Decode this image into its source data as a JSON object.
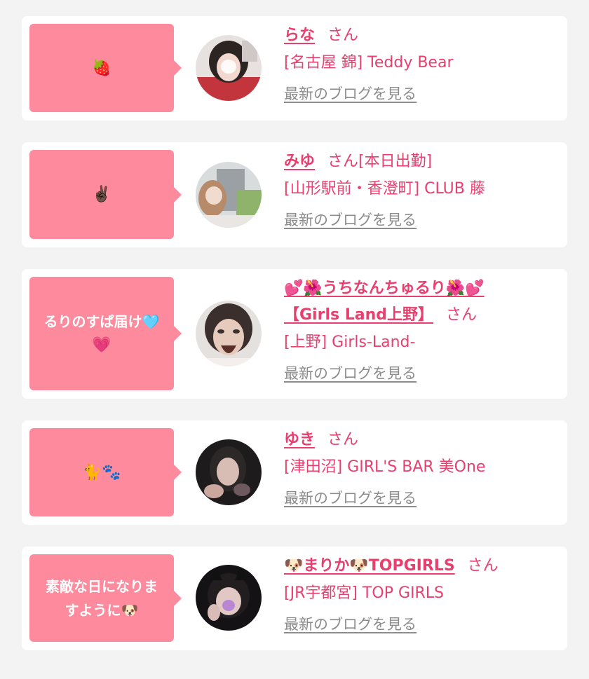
{
  "cards": [
    {
      "bubble_text": "",
      "bubble_emoji": "🍓",
      "name": "らな",
      "honorific": "さん",
      "status_tag": "",
      "shop": "[名古屋 錦] Teddy Bear",
      "blog_link": "最新のブログを見る"
    },
    {
      "bubble_text": "",
      "bubble_emoji": "✌🏿",
      "name": "みゆ",
      "honorific": "さん",
      "status_tag": "[本日出勤]",
      "shop": "[山形駅前・香澄町] CLUB 藤",
      "blog_link": "最新のブログを見る"
    },
    {
      "bubble_text": "るりのすぱ届け🩵",
      "bubble_emoji": "💗",
      "name_line1": "💕🌺うちなんちゅるり🌺💕",
      "name_line2": "【Girls Land上野】",
      "honorific": "さん",
      "shop": "[上野] Girls-Land-",
      "blog_link": "最新のブログを見る"
    },
    {
      "bubble_text": "",
      "bubble_emoji": "🐈🐾",
      "name": "ゆき",
      "honorific": "さん",
      "status_tag": "",
      "shop": "[津田沼] GIRL'S BAR 美One",
      "blog_link": "最新のブログを見る"
    },
    {
      "bubble_text": "素敵な日になりま",
      "bubble_emoji": "すように🐶",
      "name": "🐶まりか🐶TOPGIRLS",
      "honorific": "さん",
      "status_tag": "",
      "shop": "[JR宇都宮] TOP GIRLS",
      "blog_link": "最新のブログを見る"
    }
  ],
  "colors": {
    "page_bg": "#f3f3f4",
    "card_bg": "#ffffff",
    "bubble_bg": "#fe8b9d",
    "accent_pink": "#e83f6f",
    "link_gray": "#8c8c8c"
  }
}
